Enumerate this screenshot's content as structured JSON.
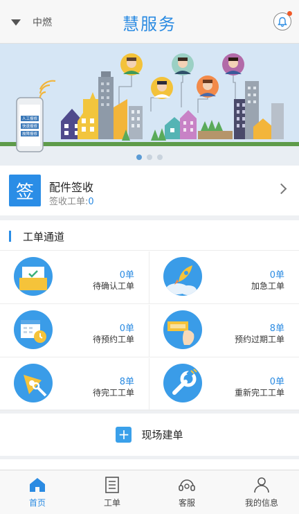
{
  "header": {
    "location": "中燃",
    "title": "慧服务"
  },
  "banner": {
    "phone_menu": [
      "人工报修",
      "快速报修",
      "故障报修"
    ],
    "slides": 3,
    "active_slide": 1
  },
  "receive": {
    "icon_char": "签",
    "title": "配件签收",
    "sub_label": "签收工单:",
    "sub_count": "0"
  },
  "channels": {
    "title": "工单通道",
    "items": [
      {
        "count": "0单",
        "label": "待确认工单",
        "icon": "confirm-order-icon"
      },
      {
        "count": "0单",
        "label": "加急工单",
        "icon": "rocket-icon"
      },
      {
        "count": "0单",
        "label": "待预约工单",
        "icon": "calendar-clock-icon"
      },
      {
        "count": "8单",
        "label": "预约过期工单",
        "icon": "expired-tag-icon"
      },
      {
        "count": "8单",
        "label": "待完工工单",
        "icon": "tools-icon"
      },
      {
        "count": "0单",
        "label": "重新完工工单",
        "icon": "wrench-icon"
      }
    ]
  },
  "create": {
    "label": "现场建单"
  },
  "tabbar": {
    "items": [
      {
        "label": "首页",
        "icon": "home-icon",
        "active": true
      },
      {
        "label": "工单",
        "icon": "order-icon",
        "active": false
      },
      {
        "label": "客服",
        "icon": "headset-icon",
        "active": false
      },
      {
        "label": "我的信息",
        "icon": "profile-icon",
        "active": false
      }
    ]
  },
  "colors": {
    "accent": "#2b8be2",
    "alert_dot": "#f05a28"
  }
}
